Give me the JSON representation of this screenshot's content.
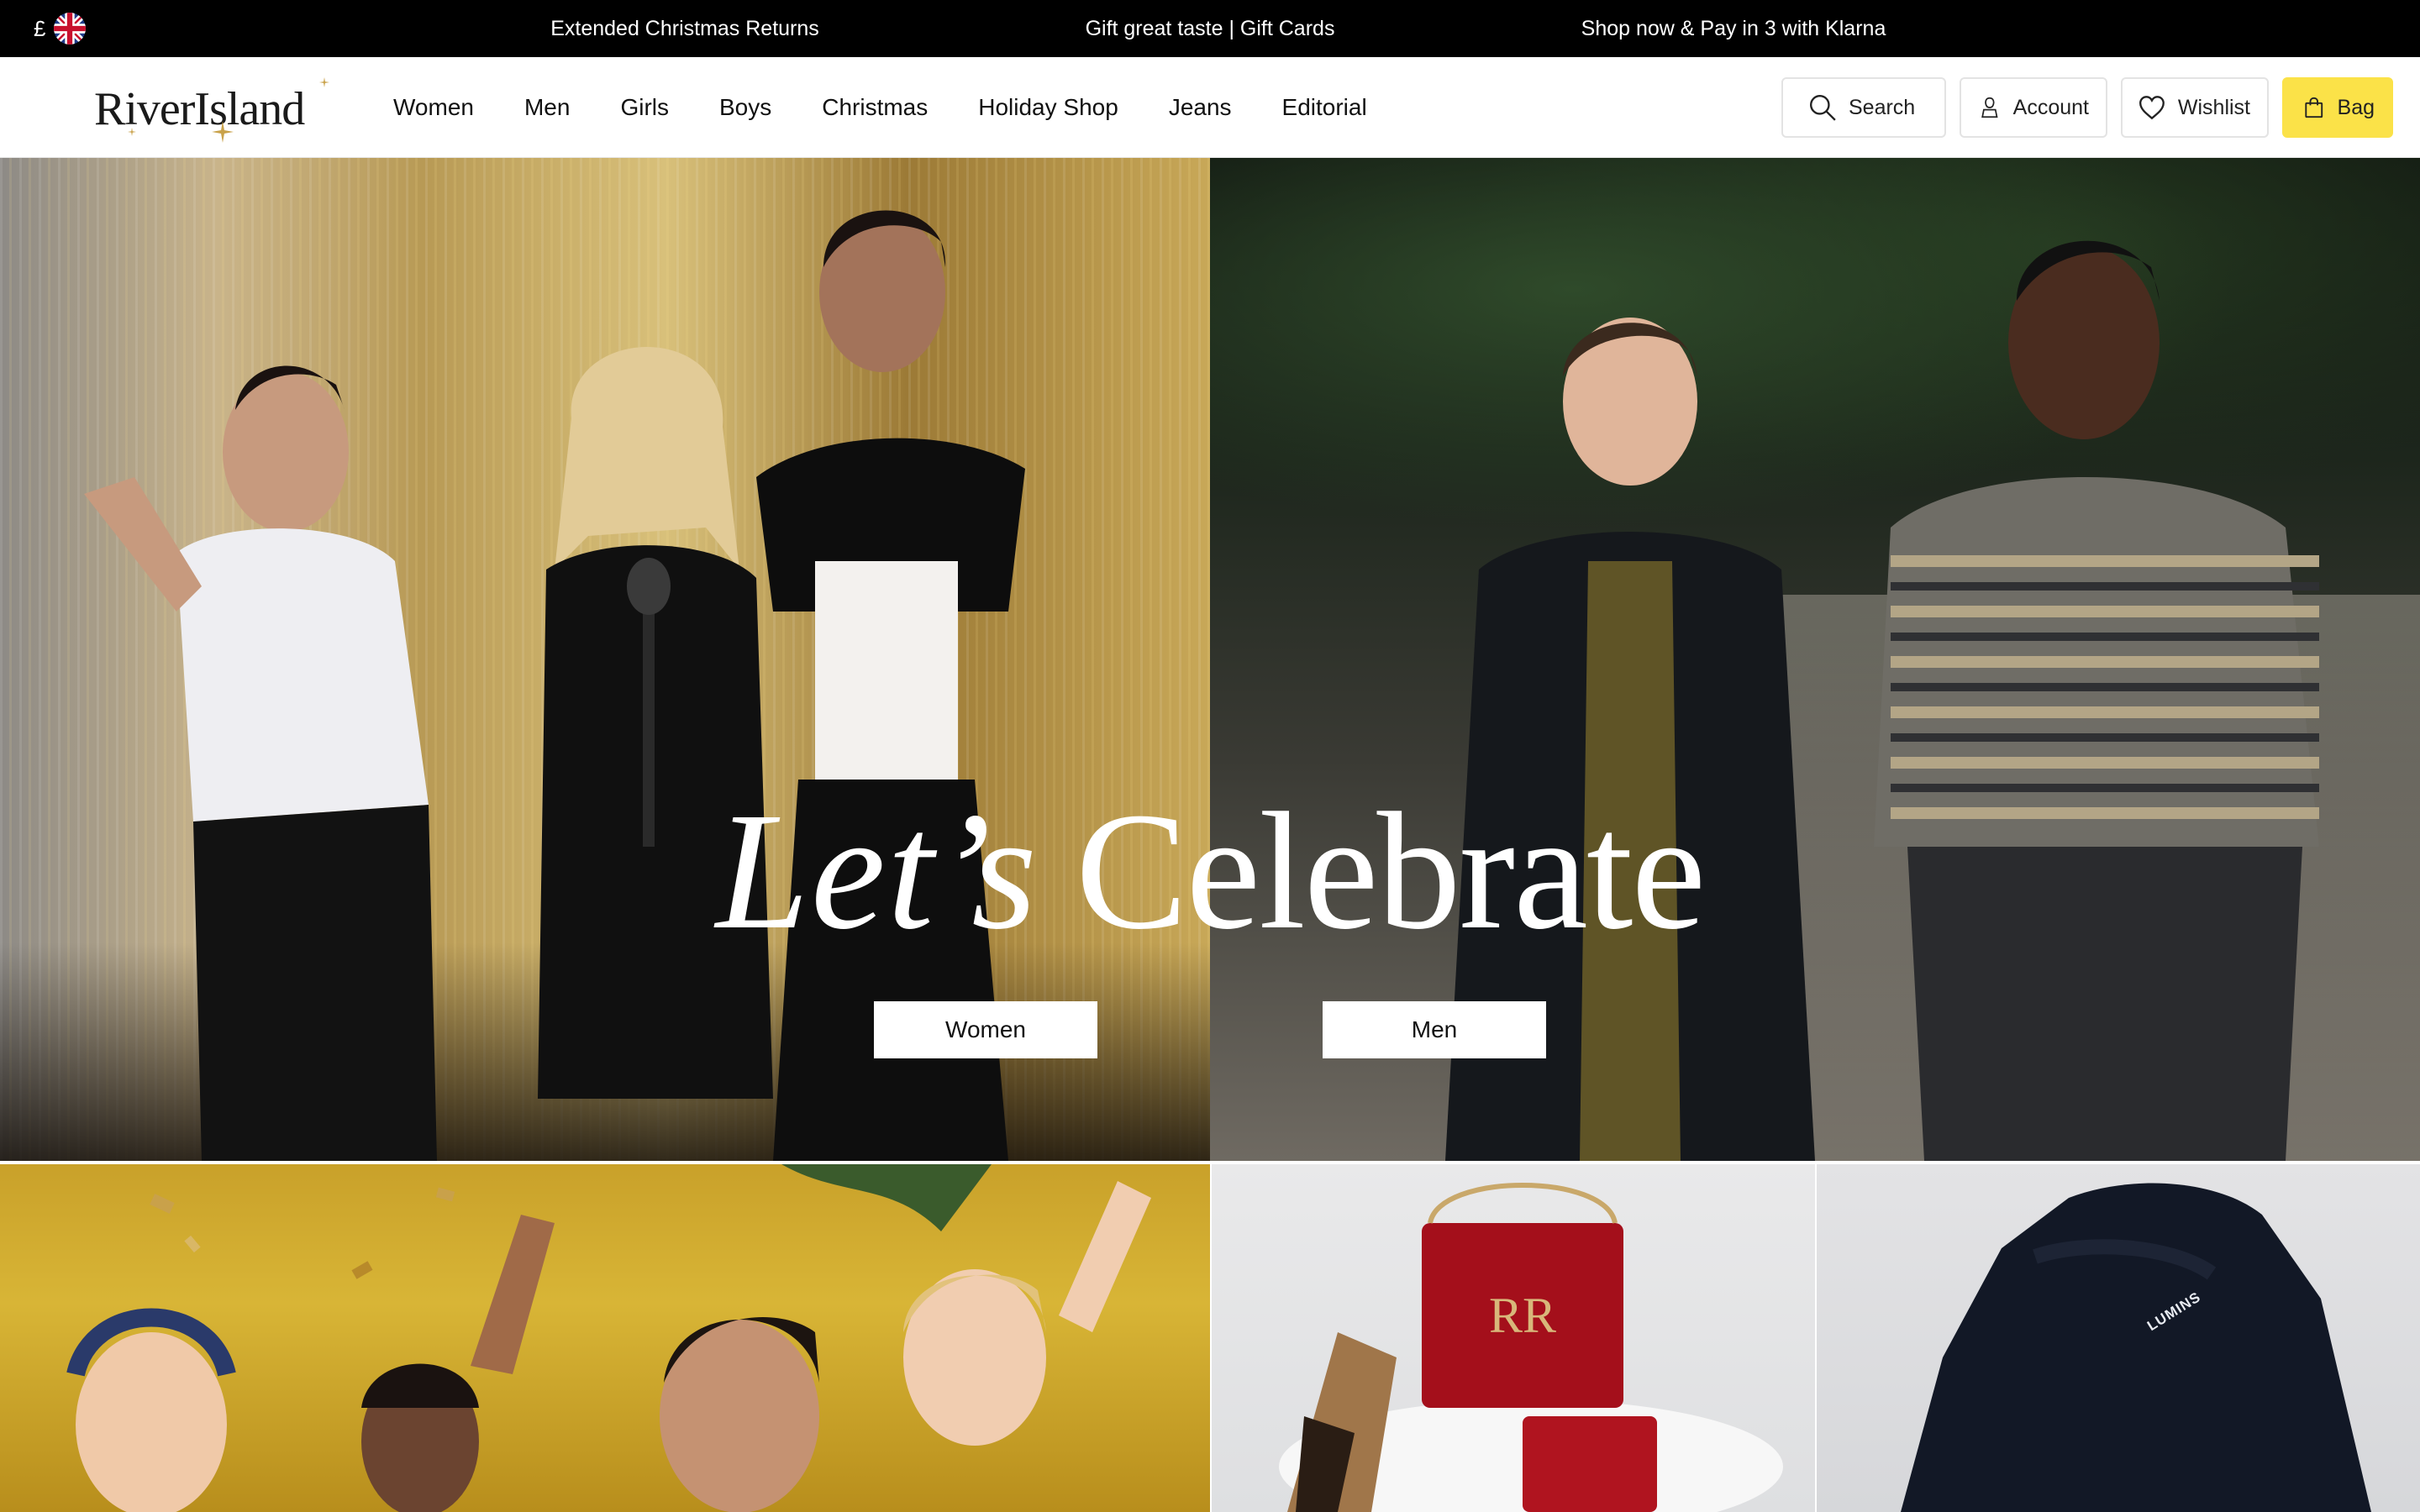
{
  "promo_bar": {
    "currency_symbol": "£",
    "region_flag_icon": "uk-flag-icon",
    "messages": [
      "Extended Christmas Returns",
      "Gift great taste | Gift Cards",
      "Shop now & Pay in 3 with Klarna"
    ]
  },
  "header": {
    "logo_text": "RiverIsland",
    "nav": [
      "Women",
      "Men",
      "Girls",
      "Boys",
      "Christmas",
      "Holiday Shop",
      "Jeans",
      "Editorial"
    ],
    "actions": {
      "search": {
        "label": "Search",
        "icon": "search-icon"
      },
      "account": {
        "label": "Account",
        "icon": "person-icon"
      },
      "wishlist": {
        "label": "Wishlist",
        "icon": "heart-icon"
      },
      "bag": {
        "label": "Bag",
        "icon": "bag-icon"
      }
    }
  },
  "hero": {
    "title_italic": "Let’s",
    "title_regular": "Celebrate",
    "cta_women": "Women",
    "cta_men": "Men"
  },
  "tiles": {
    "print_text": "LUMINS"
  },
  "colors": {
    "promo_bg": "#000000",
    "bag_button": "#fbe248",
    "hero_text": "#ffffff"
  }
}
